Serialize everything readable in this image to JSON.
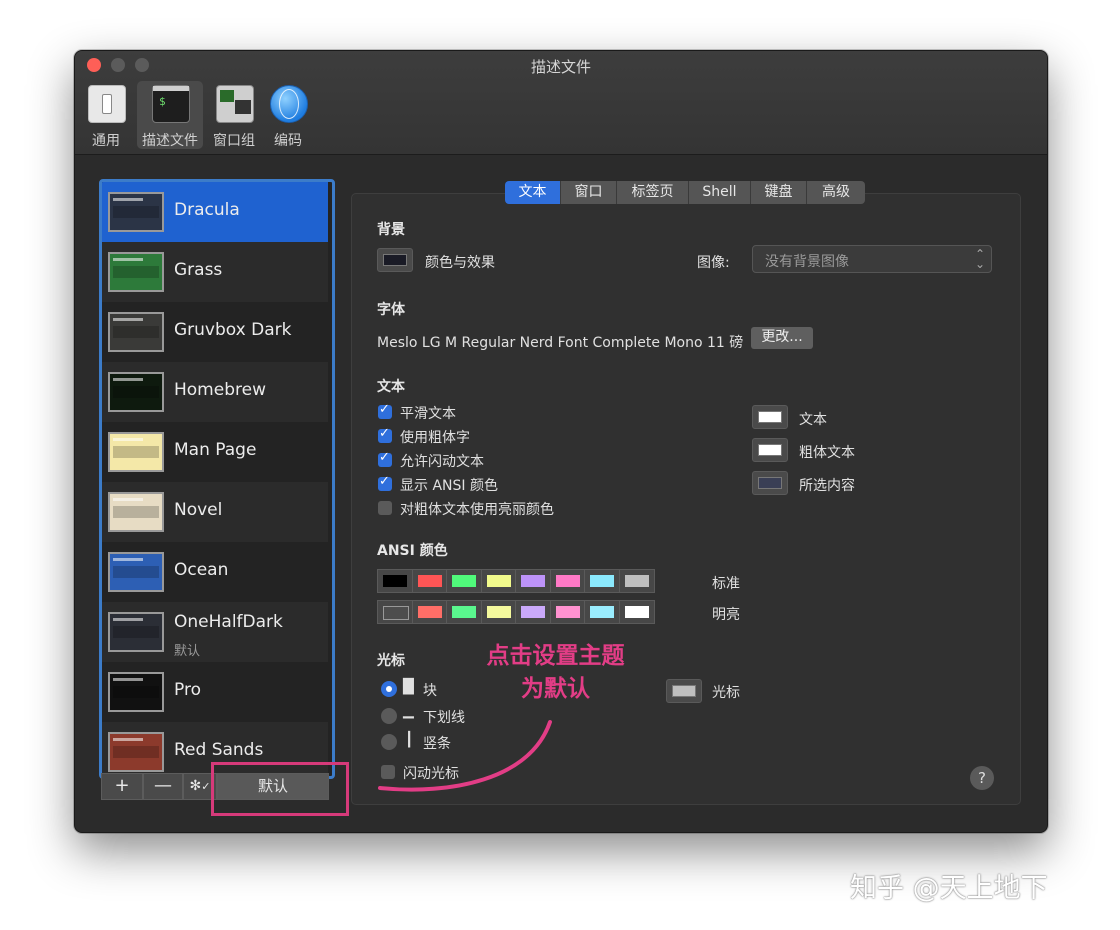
{
  "window": {
    "title": "描述文件"
  },
  "toolbar": {
    "items": [
      {
        "label": "通用",
        "icon": "general-switch-icon"
      },
      {
        "label": "描述文件",
        "icon": "terminal-profile-icon"
      },
      {
        "label": "窗口组",
        "icon": "window-groups-icon"
      },
      {
        "label": "编码",
        "icon": "globe-icon"
      }
    ]
  },
  "profiles": [
    {
      "name": "Dracula",
      "sub": "",
      "color": "#2b3446"
    },
    {
      "name": "Grass",
      "sub": "",
      "color": "#2d7a3a"
    },
    {
      "name": "Gruvbox Dark",
      "sub": "",
      "color": "#3a3a38"
    },
    {
      "name": "Homebrew",
      "sub": "",
      "color": "#0e1a0e"
    },
    {
      "name": "Man Page",
      "sub": "",
      "color": "#f4e8a8"
    },
    {
      "name": "Novel",
      "sub": "",
      "color": "#e7dcc4"
    },
    {
      "name": "Ocean",
      "sub": "",
      "color": "#2d5fb4"
    },
    {
      "name": "OneHalfDark",
      "sub": "默认",
      "color": "#2b2e36"
    },
    {
      "name": "Pro",
      "sub": "",
      "color": "#111111"
    },
    {
      "name": "Red Sands",
      "sub": "",
      "color": "#8c3a2c"
    }
  ],
  "list_buttons": {
    "add": "+",
    "remove": "—",
    "gear": "✻",
    "check": "✓",
    "default": "默认"
  },
  "tabs": [
    "文本",
    "窗口",
    "标签页",
    "Shell",
    "键盘",
    "高级"
  ],
  "background": {
    "title": "背景",
    "color_effects": "颜色与效果",
    "image_label": "图像:",
    "image_value": "没有背景图像"
  },
  "font": {
    "title": "字体",
    "value": "Meslo LG M Regular Nerd Font Complete Mono 11 磅",
    "change": "更改..."
  },
  "text": {
    "title": "文本",
    "options": [
      {
        "label": "平滑文本",
        "checked": true
      },
      {
        "label": "使用粗体字",
        "checked": true
      },
      {
        "label": "允许闪动文本",
        "checked": true
      },
      {
        "label": "显示 ANSI 颜色",
        "checked": true
      },
      {
        "label": "对粗体文本使用亮丽颜色",
        "checked": false
      }
    ],
    "colors": [
      {
        "label": "文本",
        "color": "#ffffff"
      },
      {
        "label": "粗体文本",
        "color": "#ffffff"
      },
      {
        "label": "所选内容",
        "color": "#3a3f55"
      }
    ]
  },
  "ansi": {
    "title": "ANSI 颜色",
    "normal_label": "标准",
    "bright_label": "明亮",
    "normal": [
      "#000000",
      "#ff5555",
      "#50fa7b",
      "#f1fa8c",
      "#bd93f9",
      "#ff79c6",
      "#8be9fd",
      "#bfbfbf"
    ],
    "bright": [
      "#4d4d4d",
      "#ff6e67",
      "#5af78e",
      "#f4f99d",
      "#caa9fa",
      "#ff92d0",
      "#9aedfe",
      "#ffffff"
    ]
  },
  "cursor": {
    "title": "光标",
    "options": [
      {
        "glyph": "█",
        "label": "块",
        "selected": true
      },
      {
        "glyph": "▁",
        "label": "下划线",
        "selected": false
      },
      {
        "glyph": "┃",
        "label": "竖条",
        "selected": false
      }
    ],
    "blink": "闪动光标",
    "color_label": "光标",
    "color": "#bfbfbf"
  },
  "help": "?",
  "annotation": {
    "line1": "点击设置主题",
    "line2": "为默认",
    "color": "#e23d86"
  },
  "watermark": "知乎 @天上地下"
}
